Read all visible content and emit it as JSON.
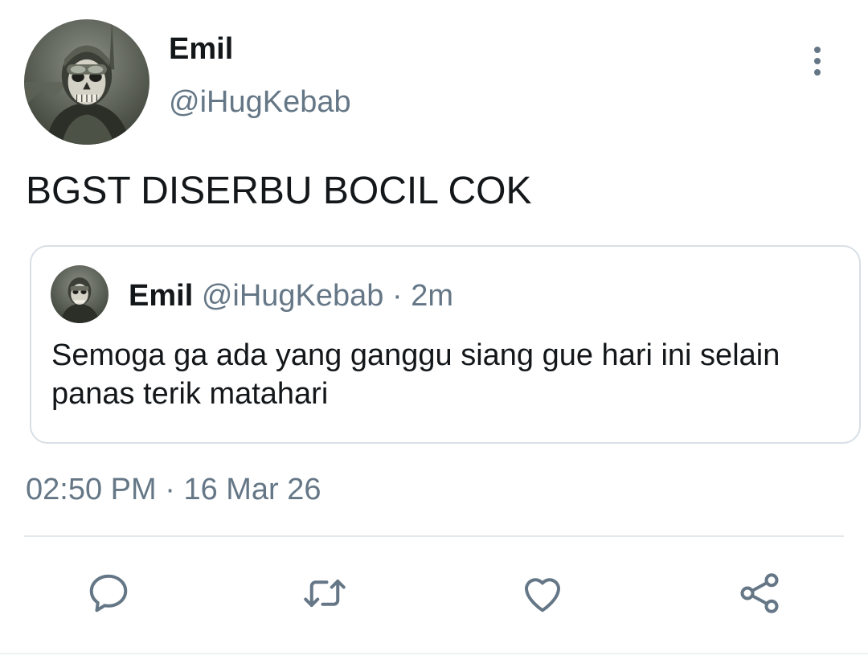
{
  "tweet": {
    "author": {
      "display_name": "Emil",
      "handle": "@iHugKebab",
      "avatar": "ghost-mask-avatar"
    },
    "text": "BGST DISERBU BOCIL COK",
    "timestamp": "02:50 PM",
    "separator": "·",
    "date": "16 Mar 26",
    "more_icon": "more-vertical-icon"
  },
  "quoted_tweet": {
    "display_name": "Emil",
    "handle": "@iHugKebab",
    "separator": "·",
    "relative_time": "2m",
    "text": "Semoga ga ada yang ganggu siang gue hari ini selain panas terik matahari"
  },
  "actions": [
    {
      "name": "reply",
      "icon": "reply-icon"
    },
    {
      "name": "retweet",
      "icon": "retweet-icon"
    },
    {
      "name": "like",
      "icon": "heart-icon"
    },
    {
      "name": "share",
      "icon": "share-icon"
    }
  ],
  "colors": {
    "text_primary": "#14171a",
    "text_secondary": "#657786",
    "border": "#d8dfe6",
    "icon": "#657786"
  }
}
